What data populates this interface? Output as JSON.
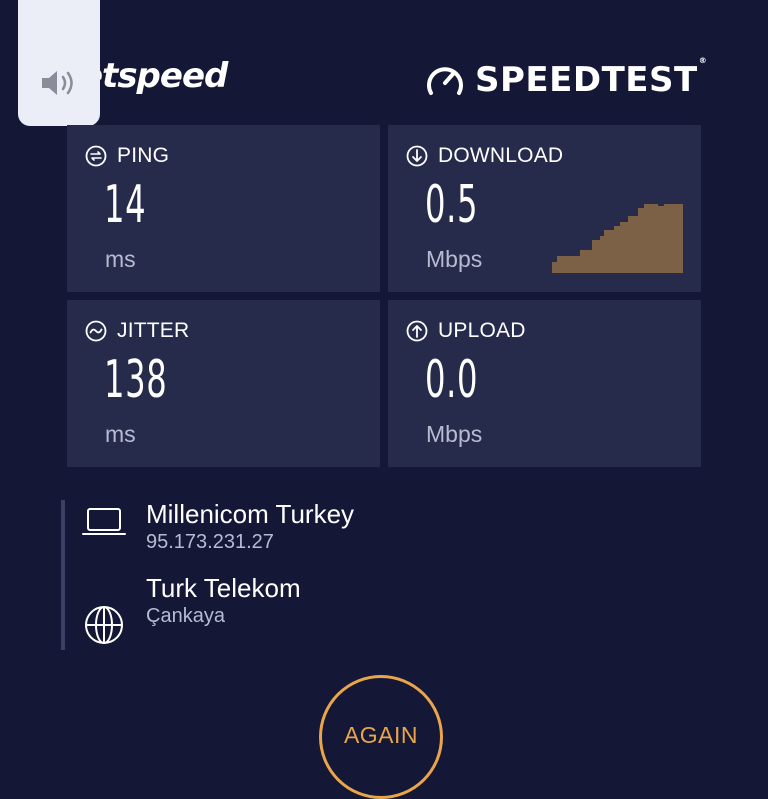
{
  "header": {
    "brand_text": "etspeed",
    "speedtest_text": "SPEEDTEST",
    "speedtest_mark": "®"
  },
  "metrics": {
    "ping": {
      "label": "PING",
      "value": "14",
      "unit": "ms",
      "icon": "ping-icon"
    },
    "download": {
      "label": "DOWNLOAD",
      "value": "0.5",
      "unit": "Mbps",
      "icon": "download-icon"
    },
    "jitter": {
      "label": "JITTER",
      "value": "138",
      "unit": "ms",
      "icon": "jitter-icon"
    },
    "upload": {
      "label": "UPLOAD",
      "value": "0.0",
      "unit": "Mbps",
      "icon": "upload-icon"
    }
  },
  "connection": {
    "client": {
      "name": "Millenicom Turkey",
      "ip": "95.173.231.27",
      "icon": "laptop-icon"
    },
    "server": {
      "name": "Turk Telekom",
      "location": "Çankaya",
      "icon": "globe-icon"
    }
  },
  "actions": {
    "again_label": "AGAIN"
  },
  "overlay": {
    "icon": "volume-icon"
  },
  "colors": {
    "background": "#141735",
    "tile": "#262b4c",
    "accent": "#e8a54a",
    "graph_fill": "#7d6147",
    "muted_text": "#b7bbd2"
  }
}
